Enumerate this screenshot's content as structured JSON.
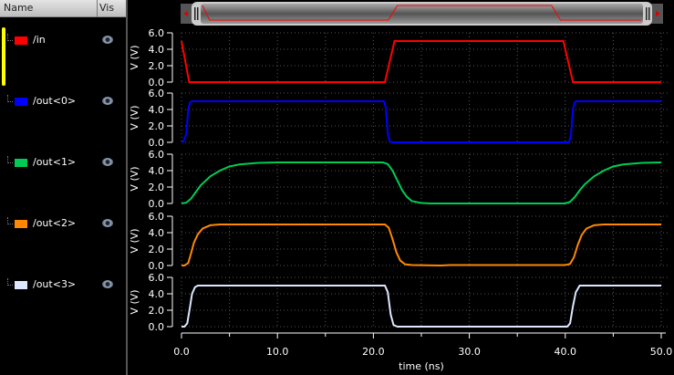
{
  "header": {
    "name_col": "Name",
    "vis_col": "Vis"
  },
  "signals": [
    {
      "name": "/in",
      "color": "#ff0000"
    },
    {
      "name": "/out<0>",
      "color": "#0000ff"
    },
    {
      "name": "/out<1>",
      "color": "#00cc55"
    },
    {
      "name": "/out<2>",
      "color": "#ff8800"
    },
    {
      "name": "/out<3>",
      "color": "#dde8ff"
    }
  ],
  "chart_data": {
    "type": "line",
    "xlabel": "time (ns)",
    "ylabel": "V (V)",
    "xlim": [
      0,
      50
    ],
    "ylim": [
      0,
      6
    ],
    "xticks": [
      "0.0",
      "10.0",
      "20.0",
      "30.0",
      "40.0",
      "50.0"
    ],
    "xtick_values": [
      0,
      10,
      20,
      30,
      40,
      50
    ],
    "yticks": [
      "0.0",
      "2.0",
      "4.0",
      "6.0"
    ],
    "ytick_values": [
      0,
      2,
      4,
      6
    ],
    "grid": true,
    "series": [
      {
        "name": "/in",
        "points": [
          [
            0,
            5
          ],
          [
            0.8,
            0
          ],
          [
            21.2,
            0
          ],
          [
            22.2,
            5
          ],
          [
            39.8,
            5
          ],
          [
            40.8,
            0
          ],
          [
            50,
            0
          ]
        ]
      },
      {
        "name": "/out<0>",
        "points": [
          [
            0,
            0
          ],
          [
            0.2,
            0.1
          ],
          [
            0.5,
            1
          ],
          [
            0.7,
            4
          ],
          [
            0.9,
            4.9
          ],
          [
            1.1,
            5
          ],
          [
            21.1,
            5
          ],
          [
            21.3,
            4.2
          ],
          [
            21.5,
            1
          ],
          [
            21.7,
            0.1
          ],
          [
            22,
            0
          ],
          [
            40.4,
            0
          ],
          [
            40.6,
            1
          ],
          [
            40.8,
            4
          ],
          [
            41,
            4.9
          ],
          [
            41.2,
            5
          ],
          [
            50,
            5
          ]
        ]
      },
      {
        "name": "/out<1>",
        "points": [
          [
            0,
            0
          ],
          [
            0.5,
            0.1
          ],
          [
            1,
            0.6
          ],
          [
            1.5,
            1.4
          ],
          [
            2,
            2.2
          ],
          [
            3,
            3.3
          ],
          [
            4,
            4.0
          ],
          [
            5,
            4.5
          ],
          [
            6,
            4.75
          ],
          [
            8,
            4.95
          ],
          [
            10,
            5
          ],
          [
            21,
            5
          ],
          [
            21.5,
            4.8
          ],
          [
            22,
            4
          ],
          [
            22.5,
            2.8
          ],
          [
            23,
            1.6
          ],
          [
            23.5,
            0.8
          ],
          [
            24,
            0.3
          ],
          [
            25,
            0.05
          ],
          [
            26,
            0
          ],
          [
            40,
            0
          ],
          [
            40.5,
            0.2
          ],
          [
            41,
            0.8
          ],
          [
            41.5,
            1.6
          ],
          [
            42,
            2.3
          ],
          [
            43,
            3.3
          ],
          [
            44,
            4.0
          ],
          [
            45,
            4.5
          ],
          [
            46,
            4.75
          ],
          [
            48,
            4.95
          ],
          [
            50,
            5
          ]
        ]
      },
      {
        "name": "/out<2>",
        "points": [
          [
            0,
            0
          ],
          [
            0.3,
            0
          ],
          [
            0.7,
            0.3
          ],
          [
            1,
            1.5
          ],
          [
            1.3,
            2.8
          ],
          [
            1.7,
            3.8
          ],
          [
            2.2,
            4.5
          ],
          [
            3,
            4.9
          ],
          [
            4,
            5
          ],
          [
            21.2,
            5
          ],
          [
            21.6,
            4.6
          ],
          [
            22,
            3.2
          ],
          [
            22.4,
            1.6
          ],
          [
            22.8,
            0.6
          ],
          [
            23.3,
            0.15
          ],
          [
            24,
            0.05
          ],
          [
            27,
            0
          ],
          [
            28,
            0.05
          ],
          [
            40,
            0.05
          ],
          [
            40.5,
            0.2
          ],
          [
            40.9,
            1
          ],
          [
            41.3,
            2.5
          ],
          [
            41.7,
            3.7
          ],
          [
            42.2,
            4.5
          ],
          [
            43,
            4.9
          ],
          [
            44,
            5
          ],
          [
            50,
            5
          ]
        ]
      },
      {
        "name": "/out<3>",
        "points": [
          [
            0,
            0
          ],
          [
            0.3,
            0
          ],
          [
            0.6,
            0.4
          ],
          [
            0.9,
            2.5
          ],
          [
            1.1,
            4
          ],
          [
            1.4,
            4.8
          ],
          [
            1.7,
            5
          ],
          [
            21.2,
            5
          ],
          [
            21.5,
            4.2
          ],
          [
            21.8,
            1.5
          ],
          [
            22.1,
            0.2
          ],
          [
            22.5,
            0
          ],
          [
            40.2,
            0
          ],
          [
            40.5,
            0.4
          ],
          [
            40.8,
            2.5
          ],
          [
            41.1,
            4.2
          ],
          [
            41.5,
            5
          ],
          [
            50,
            5
          ]
        ]
      }
    ]
  }
}
